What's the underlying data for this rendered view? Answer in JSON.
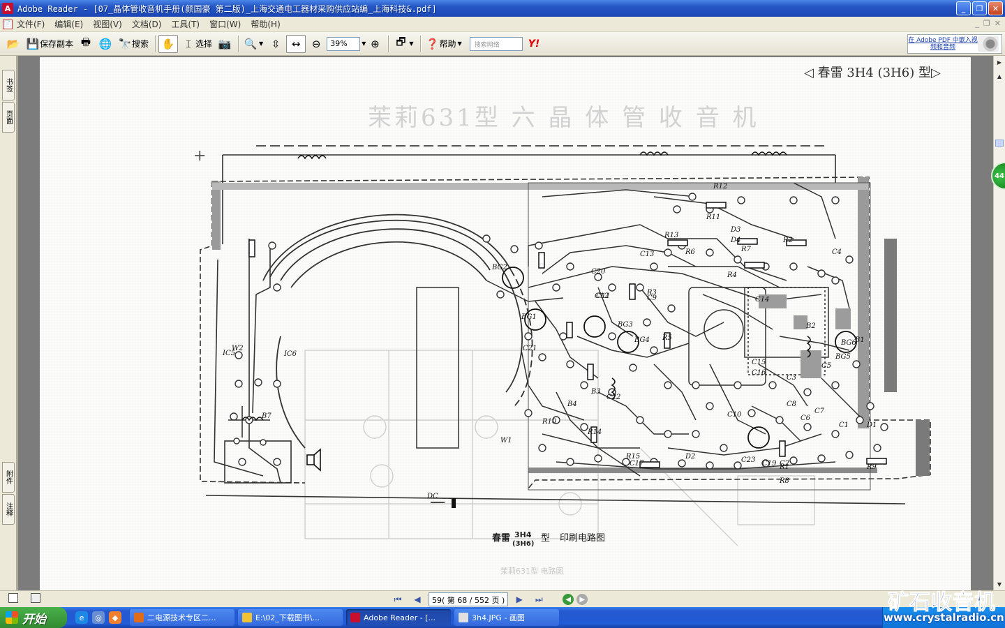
{
  "window": {
    "title": "Adobe Reader - [07_晶体管收音机手册(颜国豪 第二版)_上海交通电工器材采购供应站编_上海科技&.pdf]"
  },
  "menu": [
    "文件(F)",
    "编辑(E)",
    "视图(V)",
    "文档(D)",
    "工具(T)",
    "窗口(W)",
    "帮助(H)"
  ],
  "toolbar": {
    "save_copy": "保存副本",
    "search": "搜索",
    "select": "选择",
    "zoom": "39%",
    "help": "帮助",
    "search_web_placeholder": "搜索网络",
    "yahoo": "Y!",
    "adobe_ad": "在 Adobe PDF 中嵌入视频和音频"
  },
  "sidebar_tabs": [
    "书签",
    "页面",
    "附件",
    "注释"
  ],
  "document": {
    "header_tag": "◁ 春雷 3H4 (3H6) 型▷",
    "title": "茉莉631型 六 晶 体 管 收 音 机",
    "caption_brand": "春雷",
    "caption_model": "3H4",
    "caption_model_alt": "(3H6)",
    "caption_type": "型",
    "caption_text": "印刷电路图",
    "faint_bottom": "茉莉631型 电路图",
    "labels": [
      "R12",
      "R11",
      "D3",
      "D4",
      "R13",
      "R6",
      "R7",
      "R2",
      "C4",
      "R4",
      "BG2",
      "BG1",
      "C20",
      "C12",
      "C13",
      "R3",
      "C9",
      "BG3",
      "BG4",
      "R5",
      "C21",
      "C11",
      "C14",
      "C15",
      "BG6",
      "C3",
      "B2",
      "BG5",
      "B1",
      "C16",
      "C8",
      "C10",
      "C7",
      "C1",
      "D1",
      "D2",
      "R10",
      "R9",
      "R8",
      "C19",
      "C17",
      "W1",
      "B7",
      "IC6",
      "IC5",
      "W2",
      "R14",
      "B3",
      "B4",
      "C22",
      "R15",
      "C23",
      "C2",
      "C5",
      "C6",
      "R1",
      "DC"
    ]
  },
  "navigation": {
    "current_page": "59",
    "page_of": "( 第 68 / 552 页 )"
  },
  "taskbar": {
    "start": "开始",
    "tasks": [
      {
        "label": "二电源技术专区二...",
        "color": "#e06c1a"
      },
      {
        "label": "E:\\02_下载图书\\...",
        "color": "#f1c232"
      },
      {
        "label": "Adobe Reader - [...",
        "color": "#c8102e"
      },
      {
        "label": "3h4.JPG - 画图",
        "color": "#e0e0e0"
      }
    ]
  },
  "watermark": {
    "line1": "矿石收音机",
    "line2": "www.crystalradio.cn"
  },
  "colors": {
    "title_bar": "#2456c4",
    "taskbar": "#215bd6",
    "start_button": "#318a31",
    "document_bg": "#7c7c7c"
  }
}
